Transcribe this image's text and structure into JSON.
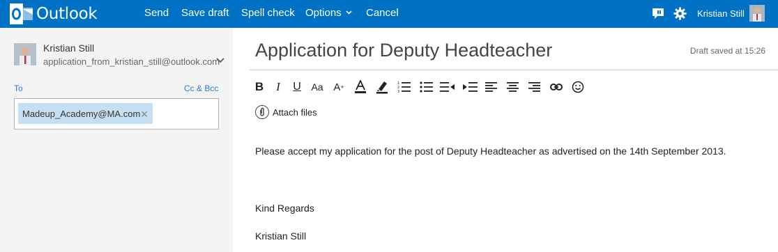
{
  "app": {
    "name": "Outlook"
  },
  "toolbar": {
    "send": "Send",
    "save_draft": "Save draft",
    "spell_check": "Spell check",
    "options": "Options",
    "cancel": "Cancel"
  },
  "user": {
    "name": "Kristian Still"
  },
  "sender": {
    "name": "Kristian Still",
    "email": "application_from_kristian_still@outlook.com"
  },
  "recipients": {
    "to_label": "To",
    "cc_bcc": "Cc & Bcc",
    "to": [
      "Madeup_Academy@MA.com"
    ]
  },
  "message": {
    "subject": "Application for Deputy Headteacher",
    "draft_status": "Draft saved at 15:26",
    "attach_label": "Attach files",
    "body_paragraph_1": "Please accept my application for the post of Deputy Headteacher as advertised on the 14th September 2013.",
    "body_closing": "Kind Regards",
    "body_signature": "Kristian Still"
  },
  "format_tools": [
    "bold-icon",
    "italic-icon",
    "underline-icon",
    "font-size-icon",
    "grow-font-icon",
    "font-color-icon",
    "highlight-icon",
    "numbered-list-icon",
    "bulleted-list-icon",
    "decrease-indent-icon",
    "increase-indent-icon",
    "align-left-icon",
    "align-center-icon",
    "align-right-icon",
    "link-icon",
    "emoticon-icon"
  ],
  "colors": {
    "brand": "#0072c6",
    "chip": "#c7dff2",
    "link": "#2d7ac7"
  }
}
